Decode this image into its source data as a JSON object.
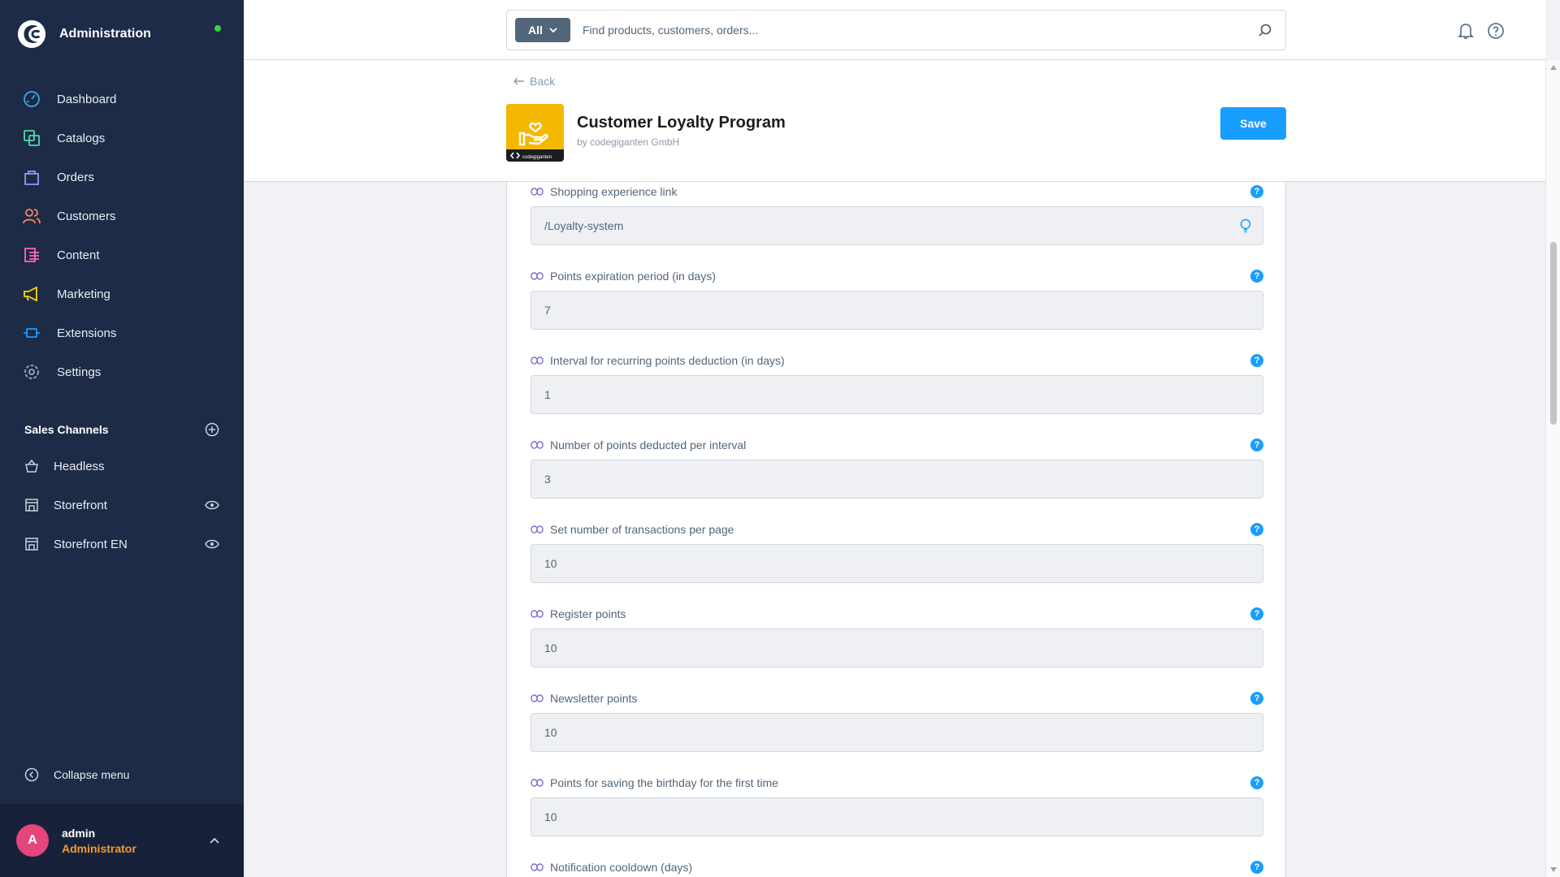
{
  "sidebar": {
    "title": "Administration",
    "status_color": "#37d046",
    "items": [
      {
        "label": "Dashboard",
        "icon": "dashboard-icon",
        "color": "#3aa9e0"
      },
      {
        "label": "Catalogs",
        "icon": "catalog-icon",
        "color": "#57d9a3"
      },
      {
        "label": "Orders",
        "icon": "orders-icon",
        "color": "#a092f0"
      },
      {
        "label": "Customers",
        "icon": "customers-icon",
        "color": "#f88962"
      },
      {
        "label": "Content",
        "icon": "content-icon",
        "color": "#ff68b4"
      },
      {
        "label": "Marketing",
        "icon": "marketing-icon",
        "color": "#ffd700"
      },
      {
        "label": "Extensions",
        "icon": "extensions-icon",
        "color": "#189eff"
      },
      {
        "label": "Settings",
        "icon": "settings-icon",
        "color": "#9aa8b5"
      }
    ],
    "sales_channels_title": "Sales Channels",
    "sales_channels": [
      {
        "label": "Headless",
        "icon": "basket-icon",
        "has_eye": false
      },
      {
        "label": "Storefront",
        "icon": "storefront-icon",
        "has_eye": true
      },
      {
        "label": "Storefront EN",
        "icon": "storefront-icon",
        "has_eye": true
      }
    ],
    "collapse_label": "Collapse menu",
    "user": {
      "initial": "A",
      "name": "admin",
      "role": "Administrator"
    }
  },
  "search": {
    "type_label": "All",
    "placeholder": "Find products, customers, orders..."
  },
  "header": {
    "back_label": "Back",
    "app_name": "Customer Loyalty Program",
    "vendor": "by codegiganten GmbH",
    "save_label": "Save",
    "icon_brand_text": "codegiganten"
  },
  "fields": [
    {
      "label": "Shopping experience link",
      "value": "/Loyalty-system",
      "has_suffix": true
    },
    {
      "label": "Points expiration period (in days)",
      "value": "7"
    },
    {
      "label": "Interval for recurring points deduction (in days)",
      "value": "1"
    },
    {
      "label": "Number of points deducted per interval",
      "value": "3"
    },
    {
      "label": "Set number of transactions per page",
      "value": "10"
    },
    {
      "label": "Register points",
      "value": "10"
    },
    {
      "label": "Newsletter points",
      "value": "10"
    },
    {
      "label": "Points for saving the birthday for the first time",
      "value": "10"
    },
    {
      "label": "Notification cooldown (days)",
      "value": ""
    }
  ],
  "help_glyph": "?"
}
